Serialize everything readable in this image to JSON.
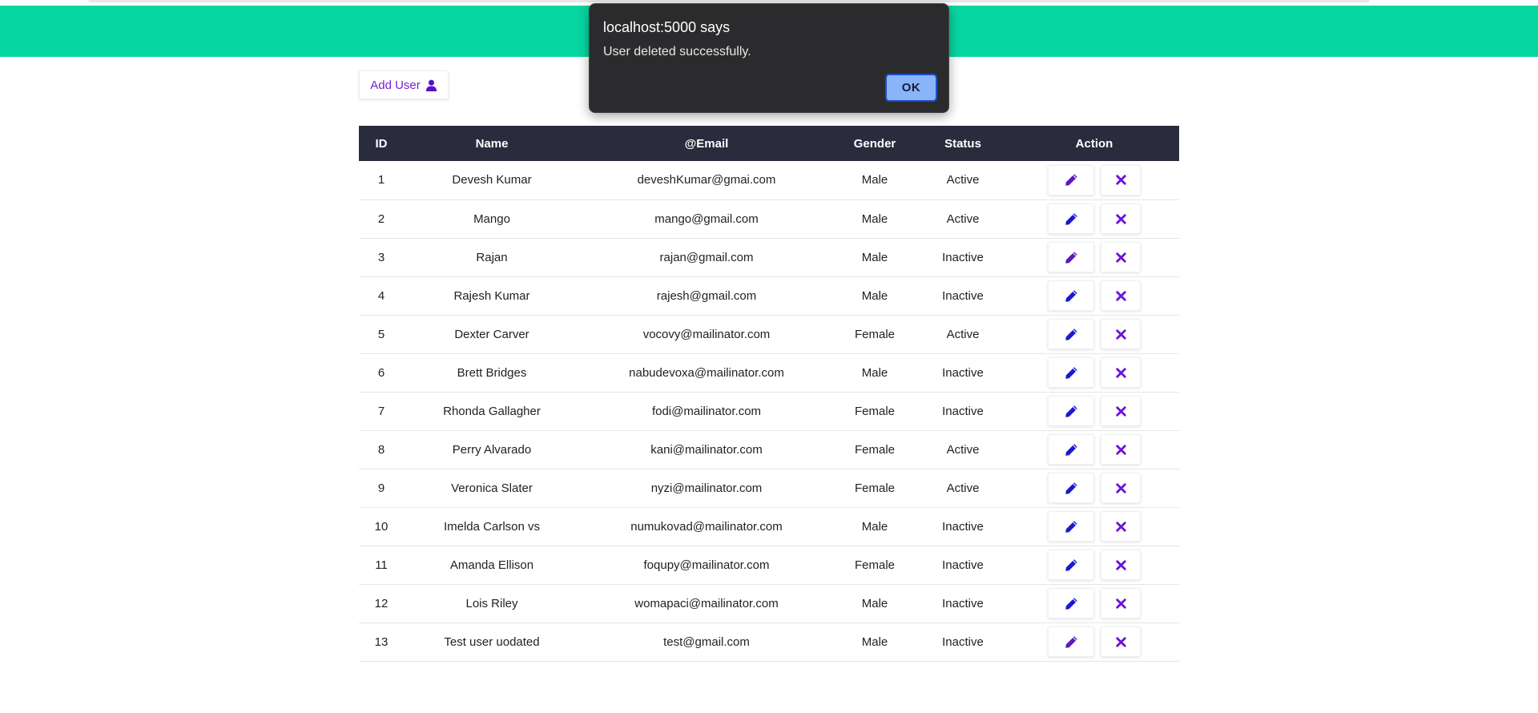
{
  "dialog": {
    "title": "localhost:5000 says",
    "message": "User deleted successfully.",
    "ok_label": "OK"
  },
  "toolbar": {
    "add_user_label": "Add User",
    "add_user_icon": "user-icon"
  },
  "table": {
    "headers": {
      "id": "ID",
      "name": "Name",
      "email": "@Email",
      "gender": "Gender",
      "status": "Status",
      "action": "Action"
    },
    "rows": [
      {
        "id": "1",
        "name": "Devesh Kumar",
        "email": "deveshKumar@gmai.com",
        "gender": "Male",
        "status": "Active"
      },
      {
        "id": "2",
        "name": "Mango",
        "email": "mango@gmail.com",
        "gender": "Male",
        "status": "Active"
      },
      {
        "id": "3",
        "name": "Rajan",
        "email": "rajan@gmail.com",
        "gender": "Male",
        "status": "Inactive"
      },
      {
        "id": "4",
        "name": "Rajesh Kumar",
        "email": "rajesh@gmail.com",
        "gender": "Male",
        "status": "Inactive"
      },
      {
        "id": "5",
        "name": "Dexter Carver",
        "email": "vocovy@mailinator.com",
        "gender": "Female",
        "status": "Active"
      },
      {
        "id": "6",
        "name": "Brett Bridges",
        "email": "nabudevoxa@mailinator.com",
        "gender": "Male",
        "status": "Inactive"
      },
      {
        "id": "7",
        "name": "Rhonda Gallagher",
        "email": "fodi@mailinator.com",
        "gender": "Female",
        "status": "Inactive"
      },
      {
        "id": "8",
        "name": "Perry Alvarado",
        "email": "kani@mailinator.com",
        "gender": "Female",
        "status": "Active"
      },
      {
        "id": "9",
        "name": "Veronica Slater",
        "email": "nyzi@mailinator.com",
        "gender": "Female",
        "status": "Active"
      },
      {
        "id": "10",
        "name": "Imelda Carlson vs",
        "email": "numukovad@mailinator.com",
        "gender": "Male",
        "status": "Inactive"
      },
      {
        "id": "11",
        "name": "Amanda Ellison",
        "email": "foqupy@mailinator.com",
        "gender": "Female",
        "status": "Inactive"
      },
      {
        "id": "12",
        "name": "Lois Riley",
        "email": "womapaci@mailinator.com",
        "gender": "Male",
        "status": "Inactive"
      },
      {
        "id": "13",
        "name": "Test user uodated",
        "email": "test@gmail.com",
        "gender": "Male",
        "status": "Inactive"
      }
    ],
    "edit_icon": "pencil-icon",
    "delete_icon": "close-icon"
  },
  "colors": {
    "header_bar": "#06d6a0",
    "table_header_bg": "#2a2c3d",
    "accent_purple": "#7a1fd6",
    "edit_blue": "#1a1acc",
    "dialog_bg": "#2b2b2d",
    "dialog_ok_bg": "#8ab4f8"
  }
}
